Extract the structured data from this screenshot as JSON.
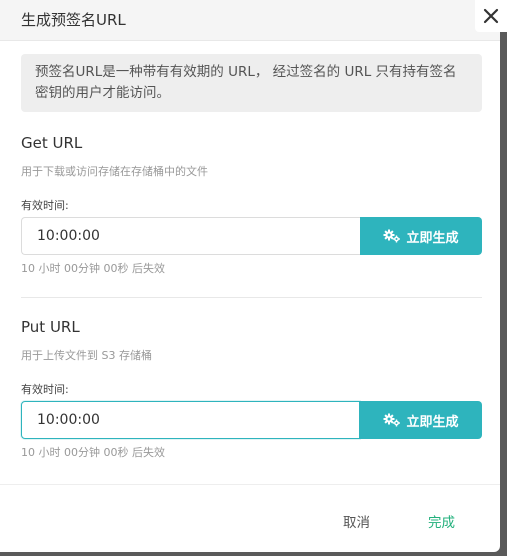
{
  "dialog": {
    "title": "生成预签名URL",
    "notice": "预签名URL是一种带有有效期的 URL， 经过签名的 URL 只有持有签名密钥的用户才能访问。"
  },
  "get_section": {
    "title": "Get URL",
    "description": "用于下载或访问存储在存储桶中的文件",
    "field_label": "有效时间:",
    "time_value": "10:00:00",
    "generate_label": "立即生成",
    "expire_hint": "10 小时 00分钟 00秒 后失效"
  },
  "put_section": {
    "title": "Put URL",
    "description": "用于上传文件到 S3 存储桶",
    "field_label": "有效时间:",
    "time_value": "10:00:00",
    "generate_label": "立即生成",
    "expire_hint": "10 小时 00分钟 00秒 后失效"
  },
  "footer": {
    "cancel_label": "取消",
    "done_label": "完成"
  },
  "colors": {
    "accent": "#2eb4bd",
    "done": "#22b07c"
  },
  "icons": {
    "close": "close-icon",
    "generate": "gears-icon"
  }
}
